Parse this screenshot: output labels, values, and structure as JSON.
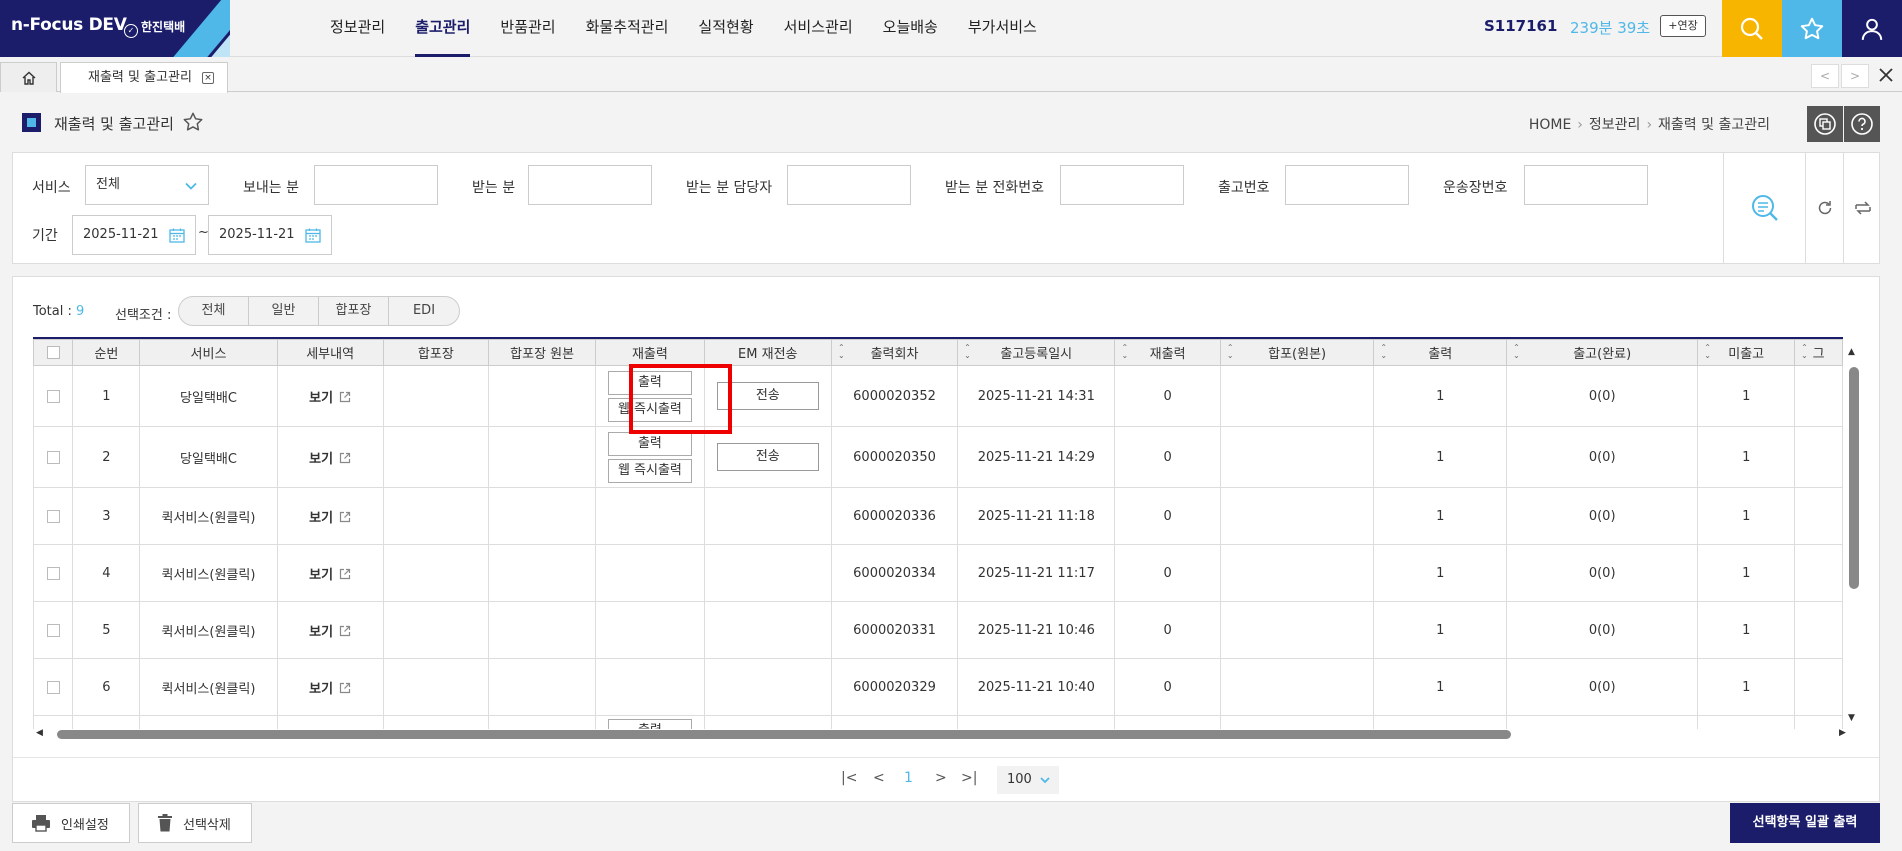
{
  "brand": {
    "app_name": "n-Focus DEV",
    "company": "한진택배"
  },
  "nav": [
    "정보관리",
    "출고관리",
    "반품관리",
    "화물추적관리",
    "실적현황",
    "서비스관리",
    "오늘배송",
    "부가서비스"
  ],
  "nav_active": "출고관리",
  "session": {
    "user_id": "S117161",
    "timer": "239분 39초",
    "extend_label": "+연장"
  },
  "tabs": {
    "current": "재출력 및 출고관리"
  },
  "page": {
    "title": "재출력 및 출고관리",
    "breadcrumb": [
      "HOME",
      "정보관리",
      "재출력 및 출고관리"
    ]
  },
  "filters": {
    "service_label": "서비스",
    "service_value": "전체",
    "sender_label": "보내는 분",
    "receiver_label": "받는 분",
    "receiver_manager_label": "받는 분 담당자",
    "receiver_phone_label": "받는 분 전화번호",
    "release_no_label": "출고번호",
    "waybill_label": "운송장번호",
    "period_label": "기간",
    "date_from": "2025-11-21",
    "date_to": "2025-11-21",
    "date_sep": "~"
  },
  "grid": {
    "total_label": "Total :",
    "total_value": "9",
    "condition_label": "선택조건 :",
    "conditions": [
      "전체",
      "일반",
      "합포장",
      "EDI"
    ],
    "columns": [
      "순번",
      "서비스",
      "세부내역",
      "합포장",
      "합포장 원본",
      "재출력",
      "EM 재전송",
      "출력회차",
      "출고등록일시",
      "재출력",
      "합포(원본)",
      "출력",
      "출고(완료)",
      "미출고",
      "그"
    ],
    "rows": [
      {
        "seq": "1",
        "service": "당일택배C",
        "detail": "보기",
        "reprint": [
          "출력",
          "웹 즉시출력"
        ],
        "em": "전송",
        "round": "6000020352",
        "datetime": "2025-11-21 14:31",
        "reprint_cnt": "0",
        "print": "1",
        "done": "0(0)",
        "pending": "1"
      },
      {
        "seq": "2",
        "service": "당일택배C",
        "detail": "보기",
        "reprint": [
          "출력",
          "웹 즉시출력"
        ],
        "em": "전송",
        "round": "6000020350",
        "datetime": "2025-11-21 14:29",
        "reprint_cnt": "0",
        "print": "1",
        "done": "0(0)",
        "pending": "1"
      },
      {
        "seq": "3",
        "service": "퀵서비스(원클릭)",
        "detail": "보기",
        "round": "6000020336",
        "datetime": "2025-11-21 11:18",
        "reprint_cnt": "0",
        "print": "1",
        "done": "0(0)",
        "pending": "1"
      },
      {
        "seq": "4",
        "service": "퀵서비스(원클릭)",
        "detail": "보기",
        "round": "6000020334",
        "datetime": "2025-11-21 11:17",
        "reprint_cnt": "0",
        "print": "1",
        "done": "0(0)",
        "pending": "1"
      },
      {
        "seq": "5",
        "service": "퀵서비스(원클릭)",
        "detail": "보기",
        "round": "6000020331",
        "datetime": "2025-11-21 10:46",
        "reprint_cnt": "0",
        "print": "1",
        "done": "0(0)",
        "pending": "1"
      },
      {
        "seq": "6",
        "service": "퀵서비스(원클릭)",
        "detail": "보기",
        "round": "6000020329",
        "datetime": "2025-11-21 10:40",
        "reprint_cnt": "0",
        "print": "1",
        "done": "0(0)",
        "pending": "1"
      }
    ],
    "partial_row_button": "출력"
  },
  "pagination": {
    "current_page": "1",
    "page_size": "100"
  },
  "bottom": {
    "print_settings": "인쇄설정",
    "delete_selected": "선택삭제",
    "batch_print": "선택항목 일괄 출력"
  },
  "colors": {
    "brand": "#1b1d6b",
    "accent": "#4fb8e8",
    "search": "#f8b500",
    "highlight": "#e00000"
  }
}
